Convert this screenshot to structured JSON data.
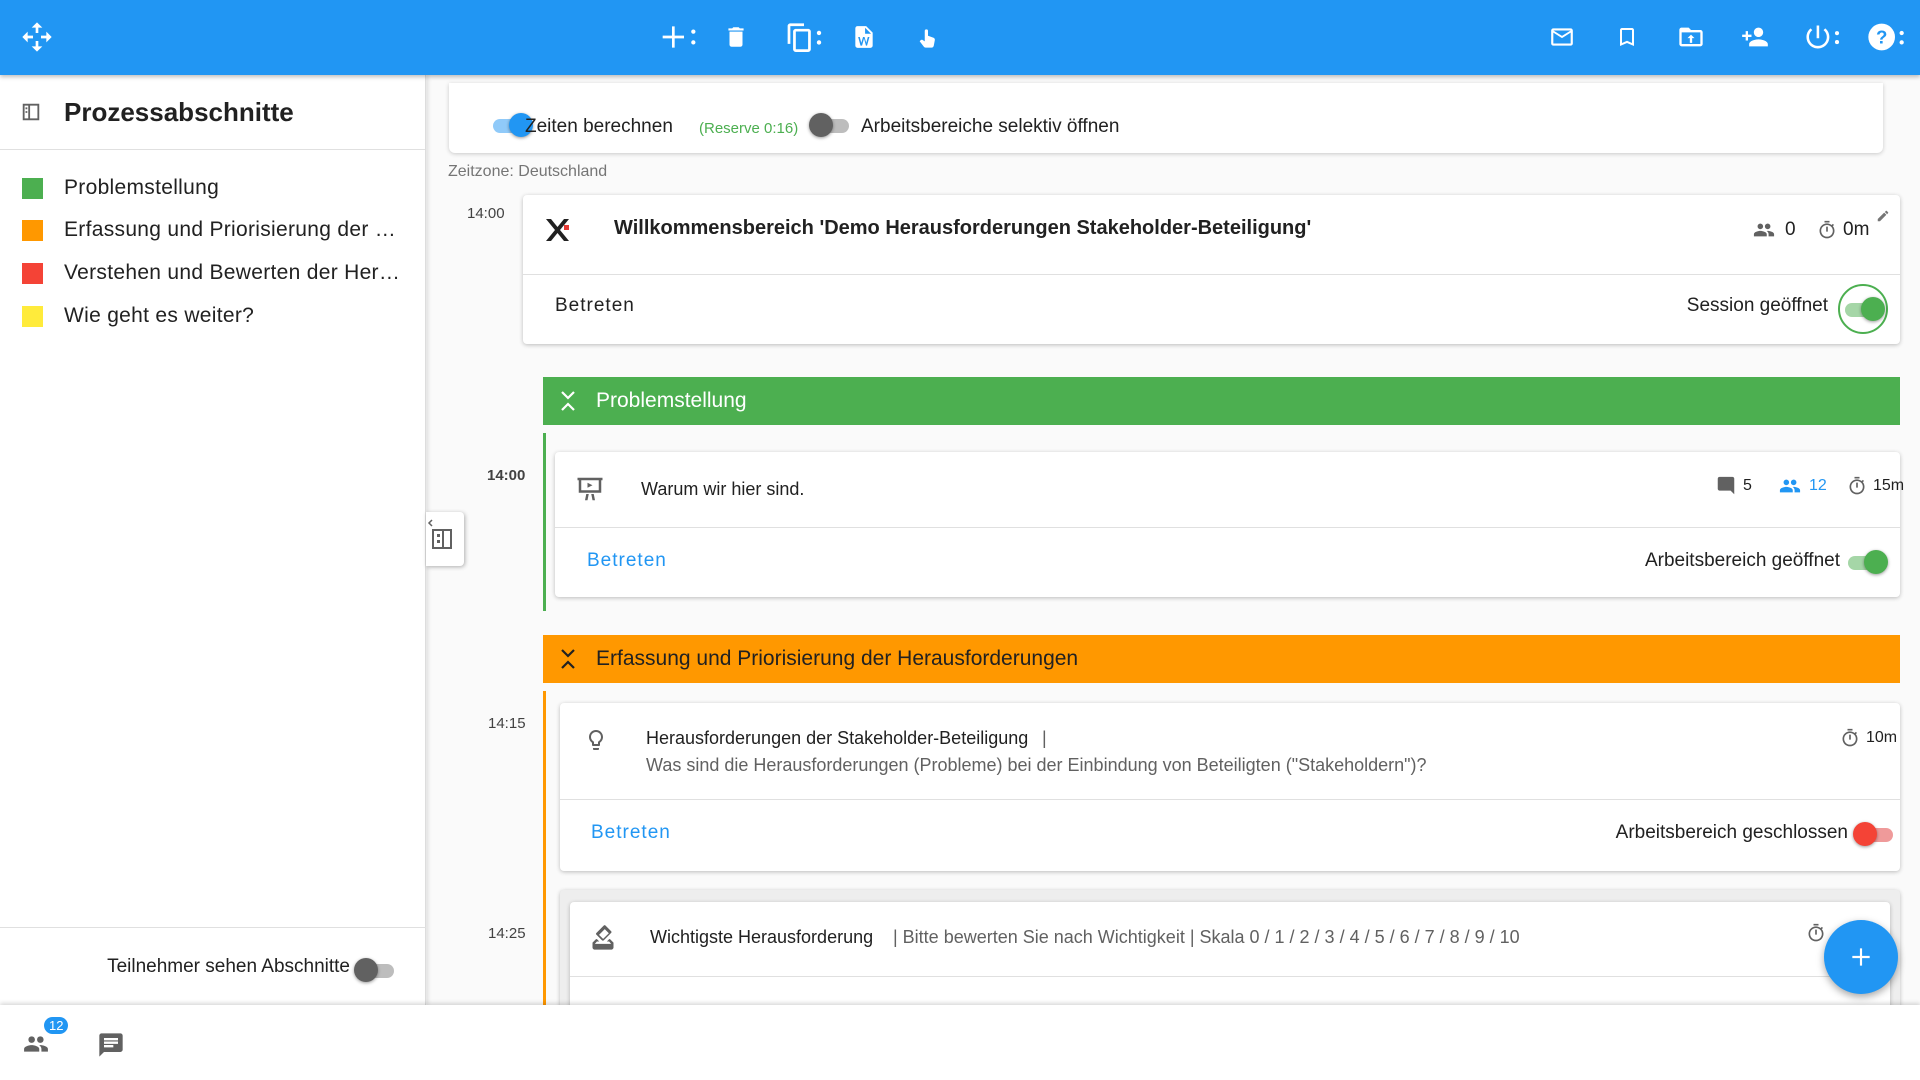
{
  "topbar": {
    "icons": [
      "move-icon",
      "add-menu-icon",
      "delete-icon",
      "copy-menu-icon",
      "word-export-icon",
      "touch-icon",
      "mail-icon",
      "bookmark-icon",
      "export-icon",
      "add-user-icon",
      "power-menu-icon",
      "help-menu-icon"
    ]
  },
  "sidebar": {
    "title": "Prozessabschnitte",
    "items": [
      {
        "label": "Problemstellung",
        "color": "#4caf50"
      },
      {
        "label": "Erfassung und Priorisierung der …",
        "color": "#ff9800"
      },
      {
        "label": "Verstehen und Bewerten der Her…",
        "color": "#f44336"
      },
      {
        "label": "Wie geht es weiter?",
        "color": "#ffeb3b"
      }
    ],
    "footer_label": "Teilnehmer sehen Abschnitte"
  },
  "options": {
    "calc_times_label": "Zeiten berechnen",
    "reserve_label": "(Reserve 0:16)",
    "selective_open_label": "Arbeitsbereiche selektiv öffnen",
    "timezone": "Zeitzone: Deutschland"
  },
  "welcome": {
    "time": "14:00",
    "title": "Willkommensbereich 'Demo Herausforderungen Stakeholder-Beteiligung'",
    "participants": "0",
    "duration": "0m",
    "enter_label": "Betreten",
    "status_label": "Session geöffnet"
  },
  "sections": [
    {
      "label": "Problemstellung",
      "color": "#4caf50",
      "items": [
        {
          "time": "14:00",
          "title": "Warum wir hier sind.",
          "comments": "5",
          "participants": "12",
          "duration": "15m",
          "enter_label": "Betreten",
          "status_label": "Arbeitsbereich geöffnet"
        }
      ]
    },
    {
      "label": "Erfassung und Priorisierung der Herausforderungen",
      "color": "#ff9800",
      "items": [
        {
          "time": "14:15",
          "title": "Herausforderungen der Stakeholder-Beteiligung",
          "separator": "|",
          "subtitle": "Was sind die Herausforderungen (Probleme) bei der Einbindung von Beteiligten (\"Stakeholdern\")?",
          "duration": "10m",
          "enter_label": "Betreten",
          "status_label": "Arbeitsbereich geschlossen"
        },
        {
          "time": "14:25",
          "title": "Wichtigste Herausforderung",
          "subtitle": "| Bitte bewerten Sie nach Wichtigkeit | Skala 0 / 1 / 2 / 3 / 4 / 5 / 6 / 7 / 8 / 9 / 10"
        }
      ]
    }
  ],
  "bottombar": {
    "participants_badge": "12"
  },
  "colors": {
    "primary": "#2196f3",
    "green": "#4caf50",
    "orange": "#ff9800",
    "red": "#f44336"
  }
}
